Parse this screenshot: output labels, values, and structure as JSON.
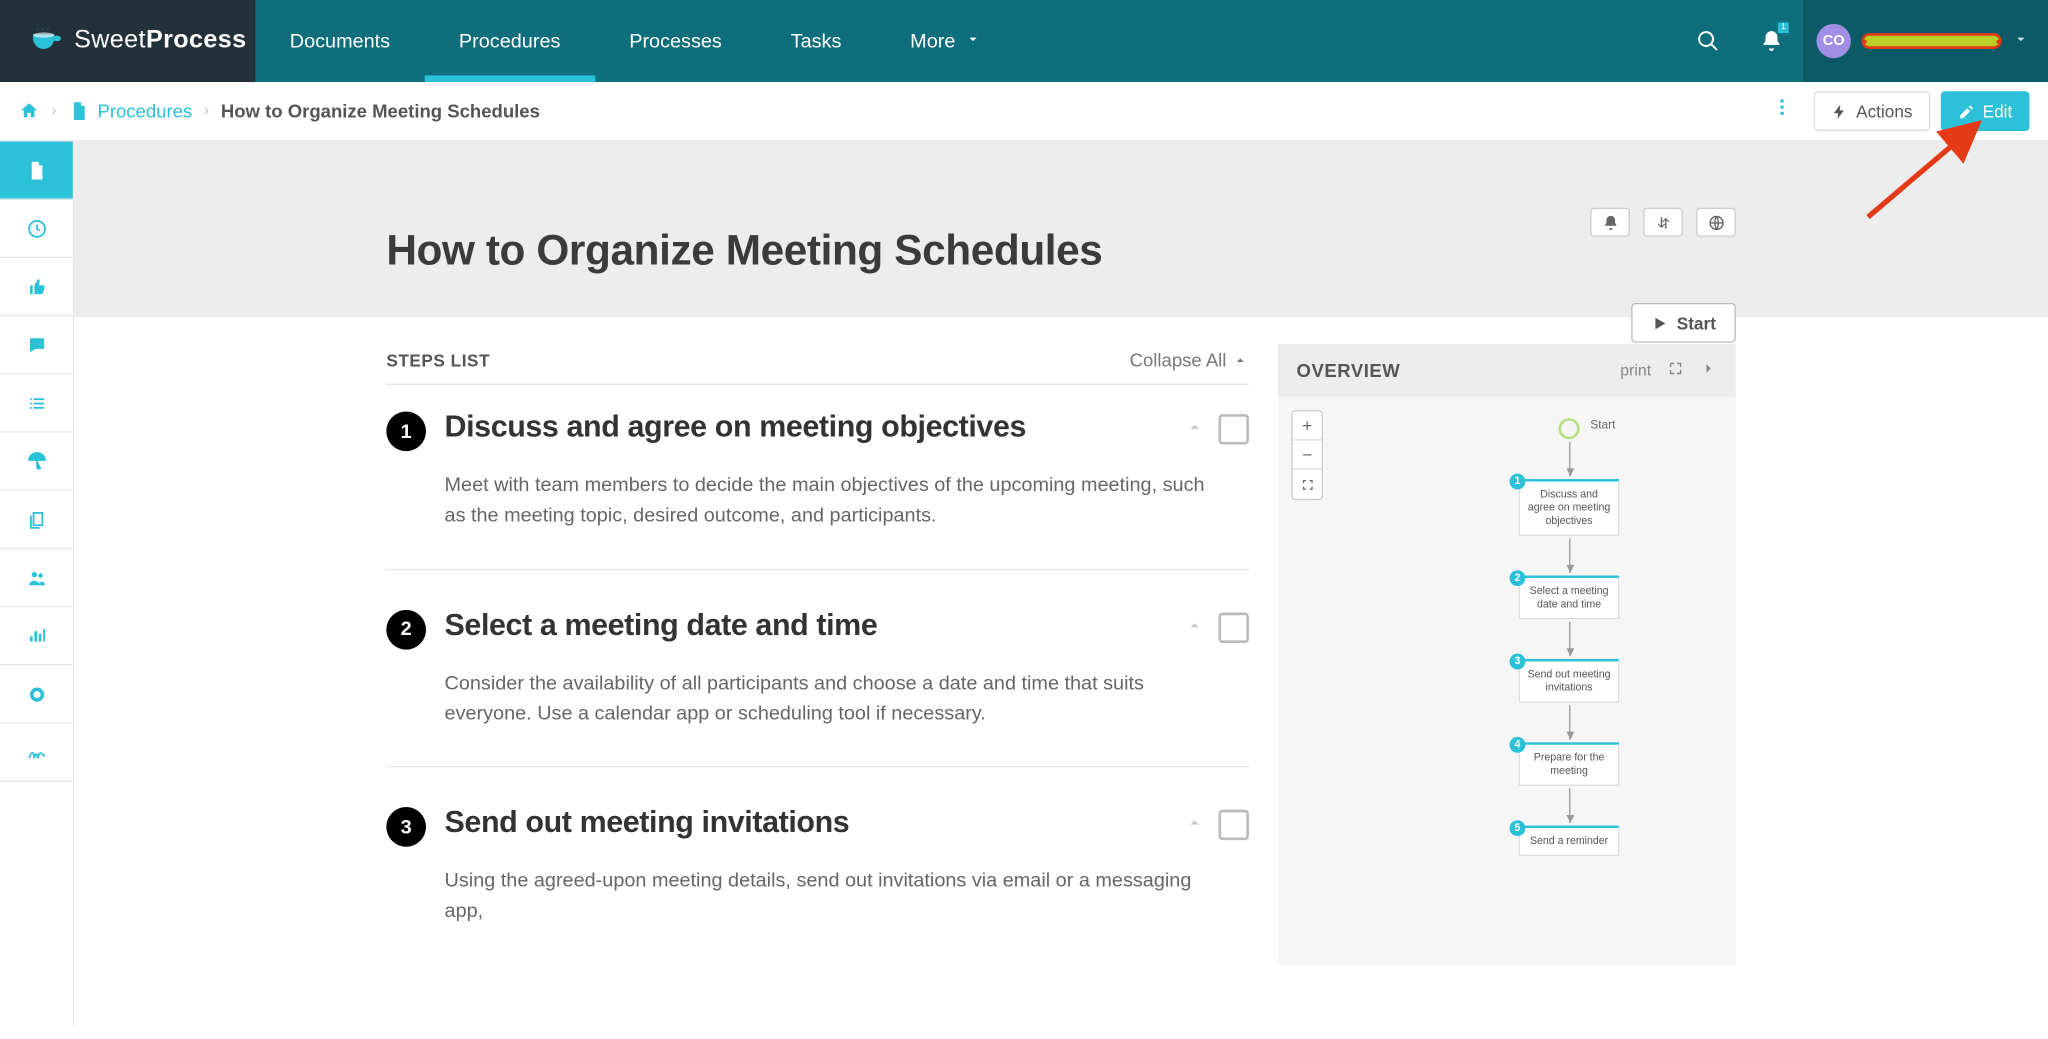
{
  "brand": {
    "name1": "Sweet",
    "name2": "Process"
  },
  "nav": {
    "items": [
      {
        "label": "Documents"
      },
      {
        "label": "Procedures",
        "active": true
      },
      {
        "label": "Processes"
      },
      {
        "label": "Tasks"
      },
      {
        "label": "More",
        "hasChevron": true
      }
    ],
    "notificationCount": "1",
    "userInitials": "CO"
  },
  "breadcrumb": {
    "section": "Procedures",
    "current": "How to Organize Meeting Schedules",
    "actionsLabel": "Actions",
    "editLabel": "Edit"
  },
  "siderail": [
    {
      "name": "file-icon",
      "active": true
    },
    {
      "name": "clock-icon"
    },
    {
      "name": "thumbs-up-icon"
    },
    {
      "name": "chat-icon"
    },
    {
      "name": "list-icon"
    },
    {
      "name": "umbrella-icon"
    },
    {
      "name": "copy-icon"
    },
    {
      "name": "people-icon"
    },
    {
      "name": "bars-icon"
    },
    {
      "name": "badge-icon"
    },
    {
      "name": "signature-icon"
    }
  ],
  "hero": {
    "title": "How to Organize Meeting Schedules",
    "startLabel": "Start"
  },
  "stepsHeader": {
    "title": "STEPS LIST",
    "collapseLabel": "Collapse All"
  },
  "steps": [
    {
      "num": "1",
      "title": "Discuss and agree on meeting objectives",
      "body": "Meet with team members to decide the main objectives of the upcoming meeting, such as the meeting topic, desired outcome, and participants."
    },
    {
      "num": "2",
      "title": "Select a meeting date and time",
      "body": "Consider the availability of all participants and choose a date and time that suits everyone. Use a calendar app or scheduling tool if necessary."
    },
    {
      "num": "3",
      "title": "Send out meeting invitations",
      "body": "Using the agreed-upon meeting details, send out invitations via email or a messaging app,"
    }
  ],
  "overview": {
    "title": "OVERVIEW",
    "printLabel": "print",
    "startLabel": "Start",
    "nodes": [
      {
        "badge": "1",
        "text": "Discuss and agree on meeting objectives"
      },
      {
        "badge": "2",
        "text": "Select a meeting date and time"
      },
      {
        "badge": "3",
        "text": "Send out meeting invitations"
      },
      {
        "badge": "4",
        "text": "Prepare for the meeting"
      },
      {
        "badge": "5",
        "text": "Send a reminder"
      }
    ]
  }
}
